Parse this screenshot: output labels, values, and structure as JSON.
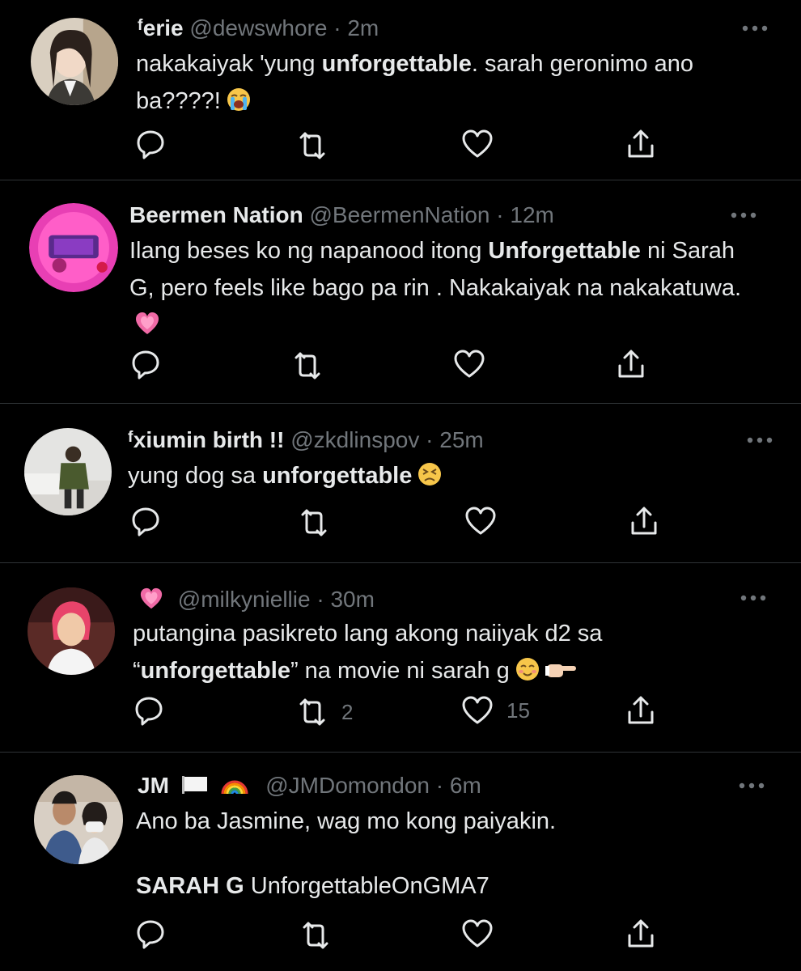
{
  "tweets": [
    {
      "name": "ᶠerie",
      "handle": "@dewswhore",
      "sep": "·",
      "time": "2m",
      "text_pre": "nakakaiyak 'yung ",
      "text_bold": "unforgettable",
      "text_post": ". sarah geronimo ano ba????!",
      "emoji": "loudly-crying-face-emoji"
    },
    {
      "name": "Beermen Nation",
      "handle": "@BeermenNation",
      "sep": "·",
      "time": "12m",
      "text_pre": "Ilang beses ko ng napanood itong ",
      "text_bold": "Unforgettable",
      "text_post": " ni Sarah G, pero feels like bago pa rin . Nakakaiyak na nakakatuwa.",
      "emoji": "growing-heart-emoji"
    },
    {
      "name": "ᶠxiumin birth !!",
      "handle": "@zkdlinspov",
      "sep": "·",
      "time": "25m",
      "text_pre": "yung dog sa ",
      "text_bold": "unforgettable",
      "text_post": "",
      "emoji": "persevering-face-emoji"
    },
    {
      "name": "",
      "handle": "@milkyniellie",
      "sep": "·",
      "time": "30m",
      "text_pre": "putangina pasikreto lang akong naiiyak d2 sa “",
      "text_bold": "unforgettable",
      "text_post": "” na movie ni sarah g",
      "emoji": "smiling-face-emoji",
      "retweets": "2",
      "likes": "15"
    },
    {
      "name": "JM",
      "handle": "@JMDomondon",
      "sep": "·",
      "time": "6m",
      "text_line1": "Ano ba Jasmine, wag mo kong paiyakin.",
      "text_bold": "SARAH G",
      "text_post": " UnforgettableOnGMA7"
    }
  ],
  "colors": {
    "background": "#000000",
    "text": "#e7e9ea",
    "muted": "#71767b",
    "divider": "#2f3336"
  }
}
